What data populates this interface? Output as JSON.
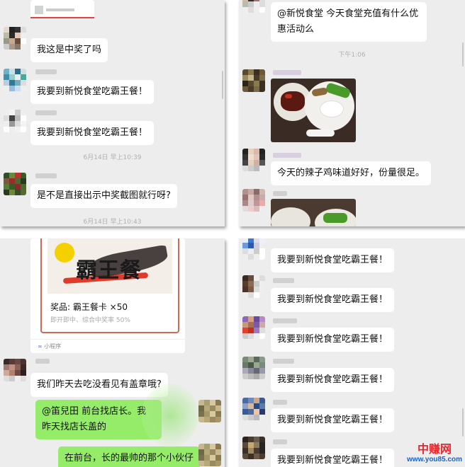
{
  "panel1": {
    "messages": [
      {
        "text": "我这是中奖了吗"
      },
      {
        "text": "我要到新悦食堂吃霸王餐！"
      },
      {
        "text": "我要到新悦食堂吃霸王餐！"
      },
      {
        "text": "是不是直接出示中奖截图就行呀?"
      }
    ],
    "timestamps": [
      "6月14日 早上10:39",
      "6月14日 早上10:43"
    ]
  },
  "panel2": {
    "messages": [
      {
        "text": "@新悦食堂  今天食堂充值有什么优惠活动么"
      },
      {
        "text": "今天的辣子鸡味道好好，份量很足。"
      }
    ],
    "timestamps": [
      "下午1:06"
    ]
  },
  "panel3": {
    "card": {
      "banner_text": "霸王餐",
      "prize_label": "奖品: 霸王餐卡  ×50",
      "prize_sub": "即开即中、综合中奖率 50%",
      "mini_program": "小程序"
    },
    "messages": [
      {
        "text": "我们昨天去吃没看见有盖章哦?"
      },
      {
        "text": "@笛兒田  前台找店长。我昨天找店长盖的"
      },
      {
        "text": "在前台，长的最帅的那个小伙仔"
      }
    ]
  },
  "panel4": {
    "messages": [
      {
        "text": "我要到新悦食堂吃霸王餐！"
      },
      {
        "text": "我要到新悦食堂吃霸王餐！"
      },
      {
        "text": "我要到新悦食堂吃霸王餐！"
      },
      {
        "text": "我要到新悦食堂吃霸王餐！"
      },
      {
        "text": "我要到新悦食堂吃霸王餐！"
      },
      {
        "text": "我要到新悦食堂吃霸王餐！"
      }
    ]
  },
  "watermark": {
    "title": "中赚网",
    "url": "www.you85.com",
    "title_color": "#e8262c",
    "url_color": "#1a62c9"
  }
}
